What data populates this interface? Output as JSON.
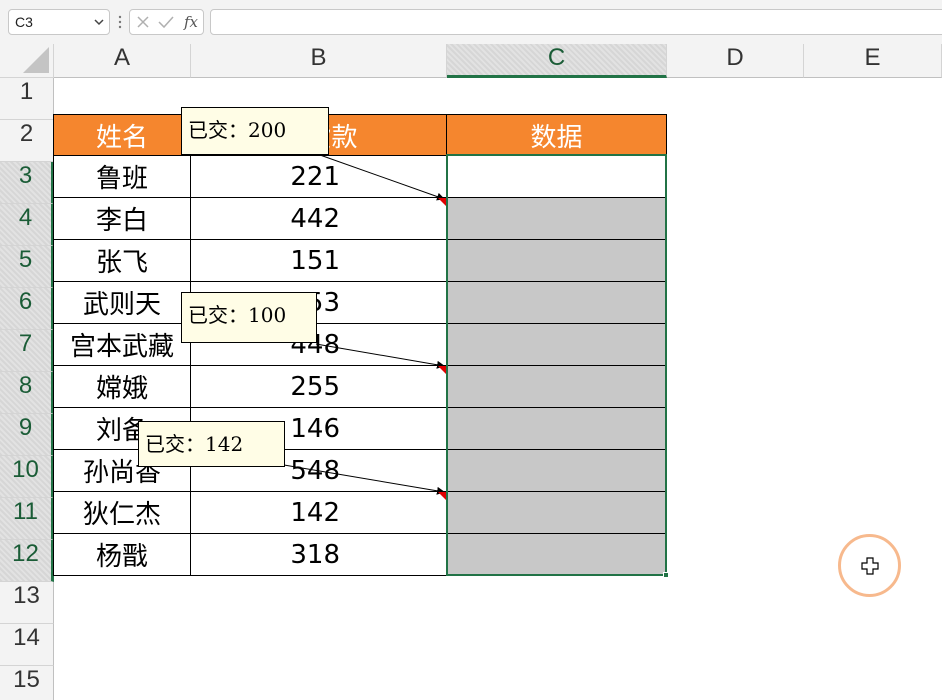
{
  "formula_bar": {
    "name_box": "C3",
    "fx": "fx",
    "formula": ""
  },
  "columns": [
    "A",
    "B",
    "C",
    "D",
    "E"
  ],
  "rows": [
    "1",
    "2",
    "3",
    "4",
    "5",
    "6",
    "7",
    "8",
    "9",
    "10",
    "11",
    "12",
    "13",
    "14",
    "15"
  ],
  "selection": {
    "column": "C",
    "rows": [
      "3",
      "4",
      "5",
      "6",
      "7",
      "8",
      "9",
      "10",
      "11",
      "12"
    ]
  },
  "table": {
    "headers": [
      "姓名",
      "交货款",
      "数据"
    ],
    "rows": [
      {
        "name": "鲁班",
        "amount": "221",
        "data": ""
      },
      {
        "name": "李白",
        "amount": "442",
        "data": ""
      },
      {
        "name": "张飞",
        "amount": "151",
        "data": ""
      },
      {
        "name": "武则天",
        "amount": "153",
        "data": ""
      },
      {
        "name": "宫本武藏",
        "amount": "448",
        "data": ""
      },
      {
        "name": "嫦娥",
        "amount": "255",
        "data": ""
      },
      {
        "name": "刘备",
        "amount": "146",
        "data": ""
      },
      {
        "name": "孙尚香",
        "amount": "548",
        "data": ""
      },
      {
        "name": "狄仁杰",
        "amount": "142",
        "data": ""
      },
      {
        "name": "杨戬",
        "amount": "318",
        "data": ""
      }
    ]
  },
  "comments": [
    {
      "cell": "C4",
      "text": "已交：200"
    },
    {
      "cell": "C8",
      "text": "已交：100"
    },
    {
      "cell": "C11",
      "text": "已交：142"
    }
  ],
  "colors": {
    "header_fill": "#f5862e",
    "selection_accent": "#217346",
    "comment_fill": "#fffde6",
    "empty_cell_fill": "#c8c8c8",
    "click_ring": "#f7b98d"
  }
}
